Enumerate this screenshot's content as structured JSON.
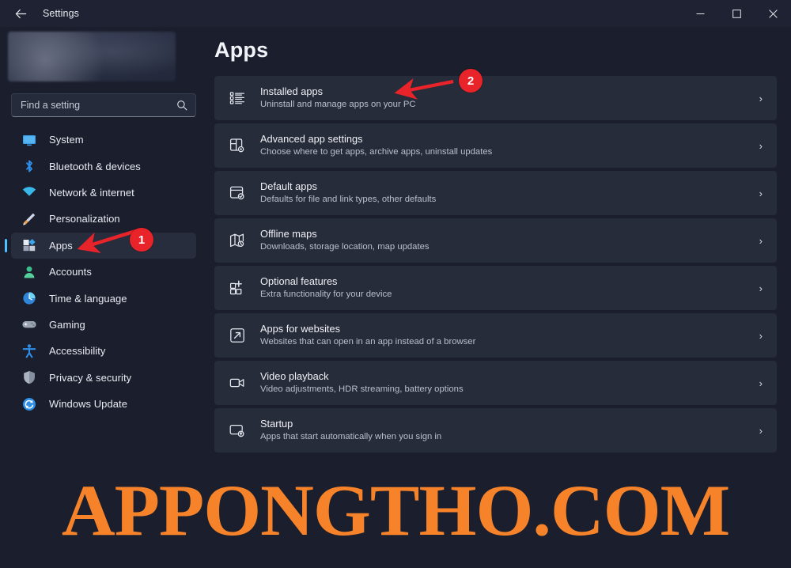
{
  "window": {
    "title": "Settings",
    "back_icon": "back-arrow-icon",
    "controls": {
      "minimize": "─",
      "maximize": "□",
      "close": "✕"
    }
  },
  "sidebar": {
    "profile": {
      "label": ""
    },
    "search": {
      "placeholder": "Find a setting",
      "value": "",
      "icon": "search-icon"
    },
    "items": [
      {
        "label": "System",
        "icon": "monitor-icon",
        "selected": false
      },
      {
        "label": "Bluetooth & devices",
        "icon": "bluetooth-icon",
        "selected": false
      },
      {
        "label": "Network & internet",
        "icon": "wifi-icon",
        "selected": false
      },
      {
        "label": "Personalization",
        "icon": "paintbrush-icon",
        "selected": false
      },
      {
        "label": "Apps",
        "icon": "apps-icon",
        "selected": true
      },
      {
        "label": "Accounts",
        "icon": "person-icon",
        "selected": false
      },
      {
        "label": "Time & language",
        "icon": "clock-globe-icon",
        "selected": false
      },
      {
        "label": "Gaming",
        "icon": "gamepad-icon",
        "selected": false
      },
      {
        "label": "Accessibility",
        "icon": "accessibility-icon",
        "selected": false
      },
      {
        "label": "Privacy & security",
        "icon": "shield-icon",
        "selected": false
      },
      {
        "label": "Windows Update",
        "icon": "update-icon",
        "selected": false
      }
    ]
  },
  "main": {
    "title": "Apps",
    "chevron": "›",
    "cards": [
      {
        "title": "Installed apps",
        "subtitle": "Uninstall and manage apps on your PC",
        "icon": "list-bullets-icon"
      },
      {
        "title": "Advanced app settings",
        "subtitle": "Choose where to get apps, archive apps, uninstall updates",
        "icon": "app-settings-icon"
      },
      {
        "title": "Default apps",
        "subtitle": "Defaults for file and link types, other defaults",
        "icon": "default-apps-icon"
      },
      {
        "title": "Offline maps",
        "subtitle": "Downloads, storage location, map updates",
        "icon": "map-icon"
      },
      {
        "title": "Optional features",
        "subtitle": "Extra functionality for your device",
        "icon": "optional-features-icon"
      },
      {
        "title": "Apps for websites",
        "subtitle": "Websites that can open in an app instead of a browser",
        "icon": "external-link-icon"
      },
      {
        "title": "Video playback",
        "subtitle": "Video adjustments, HDR streaming, battery options",
        "icon": "video-camera-icon"
      },
      {
        "title": "Startup",
        "subtitle": "Apps that start automatically when you sign in",
        "icon": "startup-icon"
      }
    ]
  },
  "annotations": {
    "color": "#e8232a",
    "steps": [
      {
        "number": "1",
        "target": "sidebar-item-apps"
      },
      {
        "number": "2",
        "target": "card-installed-apps"
      }
    ]
  },
  "watermark": {
    "text": "APPONGTHO.COM",
    "color": "#f6832a"
  }
}
